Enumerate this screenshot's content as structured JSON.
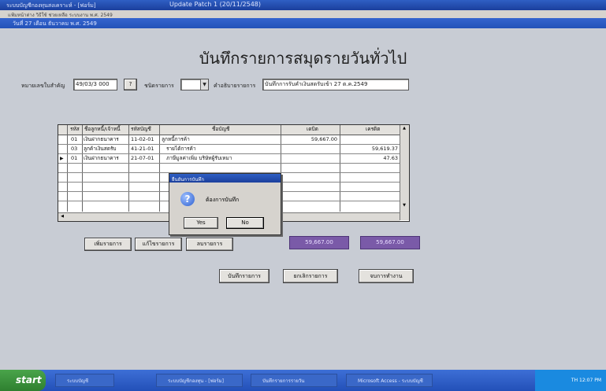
{
  "window": {
    "title_left": "ระบบบัญชีกองทุนสงเคราะห์ - [ฟอร์ม]",
    "title_center": "Update Patch 1 (20/11/2548)",
    "menu_text": "แฟ้มหน้าต่าง วิธีใช้ ช่วยเหลือ ระบบงาน พ.ศ. 2549",
    "form_title": "วันที่ 27 เดือน ธันวาคม พ.ศ. 2549"
  },
  "form": {
    "heading": "บันทึกรายการสมุดรายวันทั่วไป",
    "doc_no_label": "หมายเลขใบสำคัญ",
    "doc_no_value": "49/03/3 000",
    "help_button": "?",
    "type_label": "ชนิดรายการ",
    "type_value": "",
    "desc_label": "คำอธิบายรายการ",
    "desc_value": "บันทึกการรับคำเงินสดรับเข้า 27 ต.ค.2549"
  },
  "grid": {
    "columns": [
      "รหัส",
      "ชื่อลูกหนี้/เจ้าหนี้",
      "รหัสบัญชี",
      "ชื่อบัญชี",
      "เดบิต",
      "เครดิต"
    ],
    "rows": [
      {
        "code": "01",
        "party": "เงินฝากธนาคาร",
        "account": "11-02-01",
        "name": "ลูกหนี้การค้า",
        "debit": "59,667.00",
        "credit": ""
      },
      {
        "code": "03",
        "party": "ลูกค้าเงินสดรับ",
        "account": "41-21-01",
        "name": "รายได้การค้า",
        "debit": "",
        "credit": "59,619.37"
      },
      {
        "code": "01",
        "party": "เงินฝากธนาคาร",
        "account": "21-07-01",
        "name": "ภาษีมูลค่าเพิ่ม บริษัทผู้รับเหมา",
        "debit": "",
        "credit": "47.63"
      }
    ]
  },
  "buttons": {
    "add_item": "เพิ่มรายการ",
    "edit_item": "แก้ไขรายการ",
    "delete_item": "ลบรายการ",
    "save": "บันทึกรายการ",
    "cancel": "ยกเลิกรายการ",
    "close": "จบการทำงาน"
  },
  "totals": {
    "debit_total": "59,667.00",
    "credit_total": "59,667.00",
    "color": "#7a5aa8"
  },
  "dialog": {
    "title": "ยืนยันการบันทึก",
    "message": "ต้องการบันทึก",
    "yes": "Yes",
    "no": "No",
    "icon": "question-icon"
  },
  "taskbar": {
    "start": "start",
    "tasks": [
      "ระบบบัญชี",
      "ระบบบัญชีกองทุน - [ฟอร์ม]",
      "บันทึกรายการรายวัน",
      "Microsoft Access - ระบบบัญชี"
    ],
    "clock": "TH 12:07 PM"
  }
}
